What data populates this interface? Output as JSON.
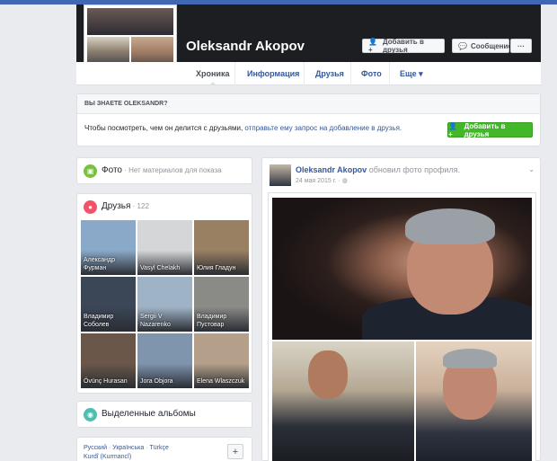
{
  "profile": {
    "name": "Oleksandr Akopov",
    "add_friend_label": "Добавить в друзья",
    "message_label": "Сообщение",
    "more_label": "···"
  },
  "tabs": [
    {
      "label": "Хроника",
      "active": true
    },
    {
      "label": "Информация",
      "active": false
    },
    {
      "label": "Друзья",
      "active": false
    },
    {
      "label": "Фото",
      "active": false
    },
    {
      "label": "Еще ▾",
      "active": false
    }
  ],
  "know": {
    "heading": "ВЫ ЗНАЕТЕ OLEKSANDR?",
    "text_prefix": "Чтобы посмотреть, чем он делится с друзьями, ",
    "text_link": "отправьте ему запрос на добавление в друзья.",
    "button_label": "Добавить в друзья"
  },
  "photos_card": {
    "title": "Фото",
    "sub": " · Нет материалов для показа"
  },
  "friends_card": {
    "title": "Друзья",
    "count": " · 122",
    "friends": [
      {
        "name": "Александр Фурман",
        "color": "#8aa9c8"
      },
      {
        "name": "Vasyl Chelakh",
        "color": "#d5d6d8"
      },
      {
        "name": "Юлия Гладун",
        "color": "#9a8063"
      },
      {
        "name": "Владимир Соболев",
        "color": "#3b4657"
      },
      {
        "name": "Sergii V Nazarenko",
        "color": "#9fb3c6"
      },
      {
        "name": "Владимир Пустовар",
        "color": "#8a8a86"
      },
      {
        "name": "Övünç Hurasan",
        "color": "#6a5749"
      },
      {
        "name": "Jora Objora",
        "color": "#7f94ad"
      },
      {
        "name": "Elena Wlaszczuk",
        "color": "#b4a08a"
      }
    ]
  },
  "albums_card": {
    "title": "Выделенные альбомы"
  },
  "lang_card": {
    "line1_a": "Русский",
    "line1_b": "Українська",
    "line1_c": "Türkçe",
    "line2": "Kurdî (Kurmancî)",
    "plus": "+"
  },
  "post": {
    "author": "Oleksandr Akopov",
    "action": " обновил фото профиля.",
    "date": "24 мая 2015 г. · ",
    "chevron": "⌄"
  }
}
